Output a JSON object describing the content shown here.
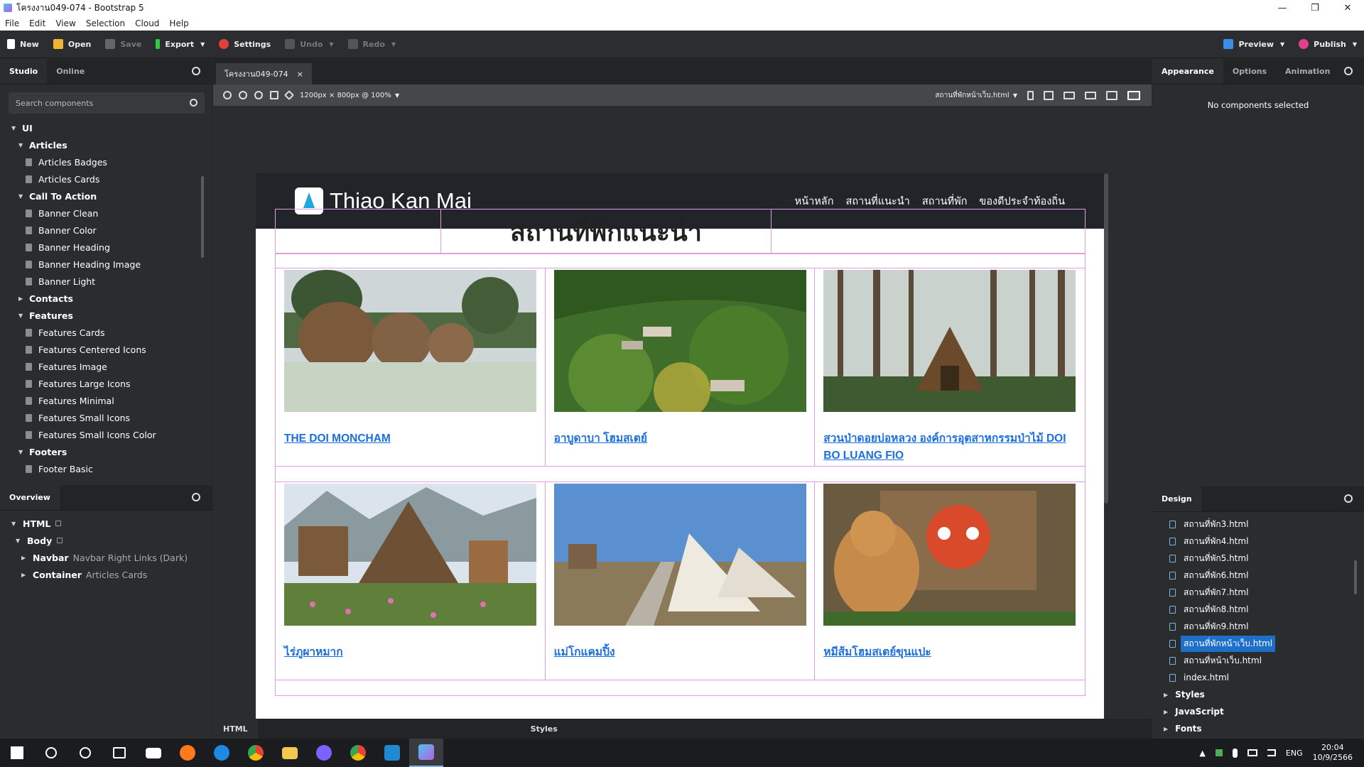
{
  "titlebar": {
    "title": "โครงงาน049-074 - Bootstrap 5",
    "minimize": "—",
    "maximize": "❐",
    "close": "✕"
  },
  "menu": [
    "File",
    "Edit",
    "View",
    "Selection",
    "Cloud",
    "Help"
  ],
  "toolbar": {
    "new": "New",
    "open": "Open",
    "save": "Save",
    "export": "Export",
    "settings": "Settings",
    "undo": "Undo",
    "redo": "Redo",
    "preview": "Preview",
    "publish": "Publish"
  },
  "left_panel": {
    "tabs": [
      "Studio",
      "Online"
    ],
    "search_placeholder": "Search components",
    "tree": [
      {
        "label": "UI",
        "level": 0,
        "expanded": true
      },
      {
        "label": "Articles",
        "level": 1,
        "expanded": true
      },
      {
        "label": "Articles Badges",
        "level": 2
      },
      {
        "label": "Articles Cards",
        "level": 2
      },
      {
        "label": "Call To Action",
        "level": 1,
        "expanded": true
      },
      {
        "label": "Banner Clean",
        "level": 2
      },
      {
        "label": "Banner Color",
        "level": 2
      },
      {
        "label": "Banner Heading",
        "level": 2
      },
      {
        "label": "Banner Heading Image",
        "level": 2
      },
      {
        "label": "Banner Light",
        "level": 2
      },
      {
        "label": "Contacts",
        "level": 1,
        "expanded": false
      },
      {
        "label": "Features",
        "level": 1,
        "expanded": true
      },
      {
        "label": "Features Cards",
        "level": 2
      },
      {
        "label": "Features Centered Icons",
        "level": 2
      },
      {
        "label": "Features Image",
        "level": 2
      },
      {
        "label": "Features Large Icons",
        "level": 2
      },
      {
        "label": "Features Minimal",
        "level": 2
      },
      {
        "label": "Features Small Icons",
        "level": 2
      },
      {
        "label": "Features Small Icons Color",
        "level": 2
      },
      {
        "label": "Footers",
        "level": 1,
        "expanded": true
      },
      {
        "label": "Footer Basic",
        "level": 2
      }
    ]
  },
  "overview": {
    "title": "Overview",
    "html": "HTML",
    "body": "Body",
    "navbar": "Navbar",
    "navbar_sub": "Navbar Right Links (Dark)",
    "container": "Container",
    "container_sub": "Articles Cards"
  },
  "editor": {
    "tab": "โครงงาน049-074",
    "tab_close": "×",
    "zoom_info": "1200px × 800px @ 100%",
    "current_file": "สถานที่พักหน้าเว็บ.html",
    "bottom_tabs": [
      "HTML",
      "Styles"
    ]
  },
  "preview_page": {
    "brand": "Thiao Kan Mai",
    "nav_links": [
      "หน้าหลัก",
      "สถานที่แนะนำ",
      "สถานที่พัก",
      "ของดีประจำท้องถิ่น"
    ],
    "heading": "สถานที่พักแนะนำ",
    "cards": [
      {
        "title": "THE DOI MONCHAM",
        "scene": "barrel-cabins"
      },
      {
        "title": "อาบูดาบา โฮมสเตย์",
        "scene": "hill-village"
      },
      {
        "title": "สวนป่าดอยบ่อหลวง องค์การอุตสาหกรรมป่าไม้ DOI BO LUANG FIO",
        "scene": "forest-hut"
      },
      {
        "title": "ไร่ภูผาหมาก",
        "scene": "a-frame-garden"
      },
      {
        "title": "แม่โกแคมปิ้ง",
        "scene": "tents"
      },
      {
        "title": "หมีส้มโฮมสเตย์ขุนแปะ",
        "scene": "bear"
      }
    ]
  },
  "right_panel": {
    "tabs": [
      "Appearance",
      "Options",
      "Animation"
    ],
    "no_selection": "No components selected",
    "design_title": "Design",
    "files": [
      "สถานที่พัก3.html",
      "สถานที่พัก4.html",
      "สถานที่พัก5.html",
      "สถานที่พัก6.html",
      "สถานที่พัก7.html",
      "สถานที่พัก8.html",
      "สถานที่พัก9.html",
      "สถานที่พักหน้าเว็บ.html",
      "สถานที่หน้าเว็บ.html",
      "index.html"
    ],
    "selected_file": "สถานที่พักหน้าเว็บ.html",
    "sections": [
      "Styles",
      "JavaScript",
      "Fonts"
    ]
  },
  "taskbar": {
    "lang": "ENG",
    "time": "20:04",
    "date": "10/9/2566"
  },
  "colors": {
    "accent": "#1e6fc9",
    "link": "#1a6fe0",
    "grid_border": "#e09ee0"
  }
}
